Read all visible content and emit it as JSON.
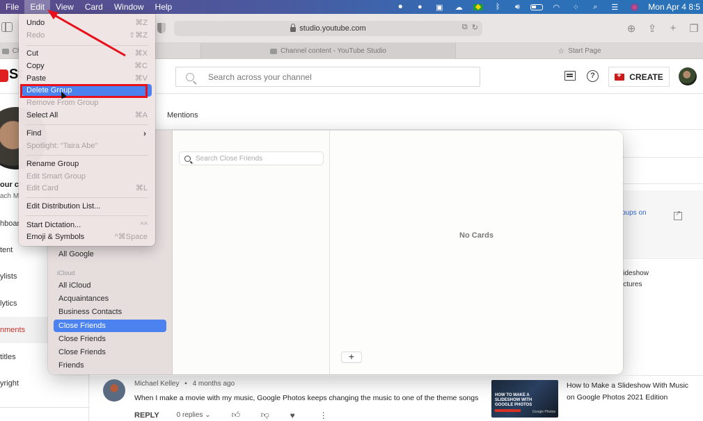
{
  "menubar": {
    "items": [
      "File",
      "Edit",
      "View",
      "Card",
      "Window",
      "Help"
    ],
    "active_item": "Edit",
    "status_icons": [
      "screen-record-icon",
      "notification-badge-icon",
      "zoom-icon",
      "cloud-sync-icon",
      "brazil-flag-icon",
      "bluetooth-icon",
      "volume-icon",
      "battery-icon",
      "wifi-icon",
      "dots-icon",
      "spotlight-search-icon",
      "control-center-icon",
      "siri-icon"
    ],
    "clock": "Mon Apr 4  8:5"
  },
  "browser": {
    "url": "studio.youtube.com",
    "tabs": [
      {
        "label": "Cha",
        "icon": "youtube-icon"
      },
      {
        "label": "Channel content - YouTube Studio",
        "icon": "youtube-icon"
      },
      {
        "label": "Start Page",
        "icon": "star-icon"
      }
    ]
  },
  "youtube": {
    "logo_text": "St",
    "search_placeholder": "Search across your channel",
    "create_label": "CREATE",
    "help_glyph": "?",
    "channel_name_partial": "our ch",
    "channel_sub_partial": "ach M",
    "nav_items": [
      {
        "label": "hboar",
        "active": false
      },
      {
        "label": "tent",
        "active": false
      },
      {
        "label": "ylists",
        "active": false
      },
      {
        "label": "lytics",
        "active": false
      },
      {
        "label": "nments",
        "active": true
      },
      {
        "label": "titles",
        "active": false
      },
      {
        "label": "yright",
        "active": false
      }
    ],
    "tab_mentions": "Mentions",
    "side_link_partial": "oups on",
    "side_video_partial": [
      "lideshow",
      "ictures"
    ],
    "comment": {
      "author": "Michael Kelley",
      "age": "4 months ago",
      "separator": "•",
      "text": "When I make a movie with my music, Google Photos keeps changing the music to one of the theme songs",
      "reply_label": "REPLY",
      "replies_label": "0 replies",
      "video_title": "How to Make a Slideshow With Music on Google Photos 2021 Edition",
      "thumb_text": "HOW TO MAKE A SLIDESHOW WITH GOOGLE PHOTOS",
      "thumb_brand": "Google Photos"
    }
  },
  "edit_menu": {
    "items": [
      {
        "label": "Undo",
        "shortcut": "⌘Z",
        "disabled": false
      },
      {
        "label": "Redo",
        "shortcut": "⇧⌘Z",
        "disabled": true
      },
      {
        "label": "Cut",
        "shortcut": "⌘X",
        "disabled": false
      },
      {
        "label": "Copy",
        "shortcut": "⌘C",
        "disabled": false
      },
      {
        "label": "Paste",
        "shortcut": "⌘V",
        "disabled": false
      },
      {
        "label": "Delete Group",
        "shortcut": "",
        "disabled": false,
        "highlighted": true
      },
      {
        "label": "Remove From Group",
        "shortcut": "",
        "disabled": true
      },
      {
        "label": "Select All",
        "shortcut": "⌘A",
        "disabled": false
      },
      {
        "label": "Find",
        "shortcut": "",
        "disabled": false,
        "submenu": true
      },
      {
        "label": "Spotlight: “Taira Abe”",
        "shortcut": "",
        "disabled": true
      },
      {
        "label": "Rename Group",
        "shortcut": "",
        "disabled": false
      },
      {
        "label": "Edit Smart Group",
        "shortcut": "",
        "disabled": true
      },
      {
        "label": "Edit Card",
        "shortcut": "⌘L",
        "disabled": true
      },
      {
        "label": "Edit Distribution List...",
        "shortcut": "",
        "disabled": false
      },
      {
        "label": "Start Dictation...",
        "shortcut": "^^",
        "disabled": false
      },
      {
        "label": "Emoji & Symbols",
        "shortcut": "^⌘Space",
        "disabled": false
      }
    ],
    "submenu_glyph": "›"
  },
  "contacts": {
    "groups": {
      "all_google": "All Google",
      "icloud_header": "iCloud",
      "items": [
        {
          "label": "All iCloud",
          "selected": false
        },
        {
          "label": "Acquaintances",
          "selected": false
        },
        {
          "label": "Business Contacts",
          "selected": false
        },
        {
          "label": "Close Friends",
          "selected": true
        },
        {
          "label": "Close Friends",
          "selected": false
        },
        {
          "label": "Close Friends",
          "selected": false
        },
        {
          "label": "Friends",
          "selected": false
        }
      ]
    },
    "search_placeholder": "Search Close Friends",
    "empty_label": "No Cards",
    "add_label": "+"
  },
  "colors": {
    "selection_blue": "#4b82f0",
    "annotation_red": "#e8101a",
    "youtube_red": "#cc1a1a",
    "link_blue": "#3366cc"
  }
}
